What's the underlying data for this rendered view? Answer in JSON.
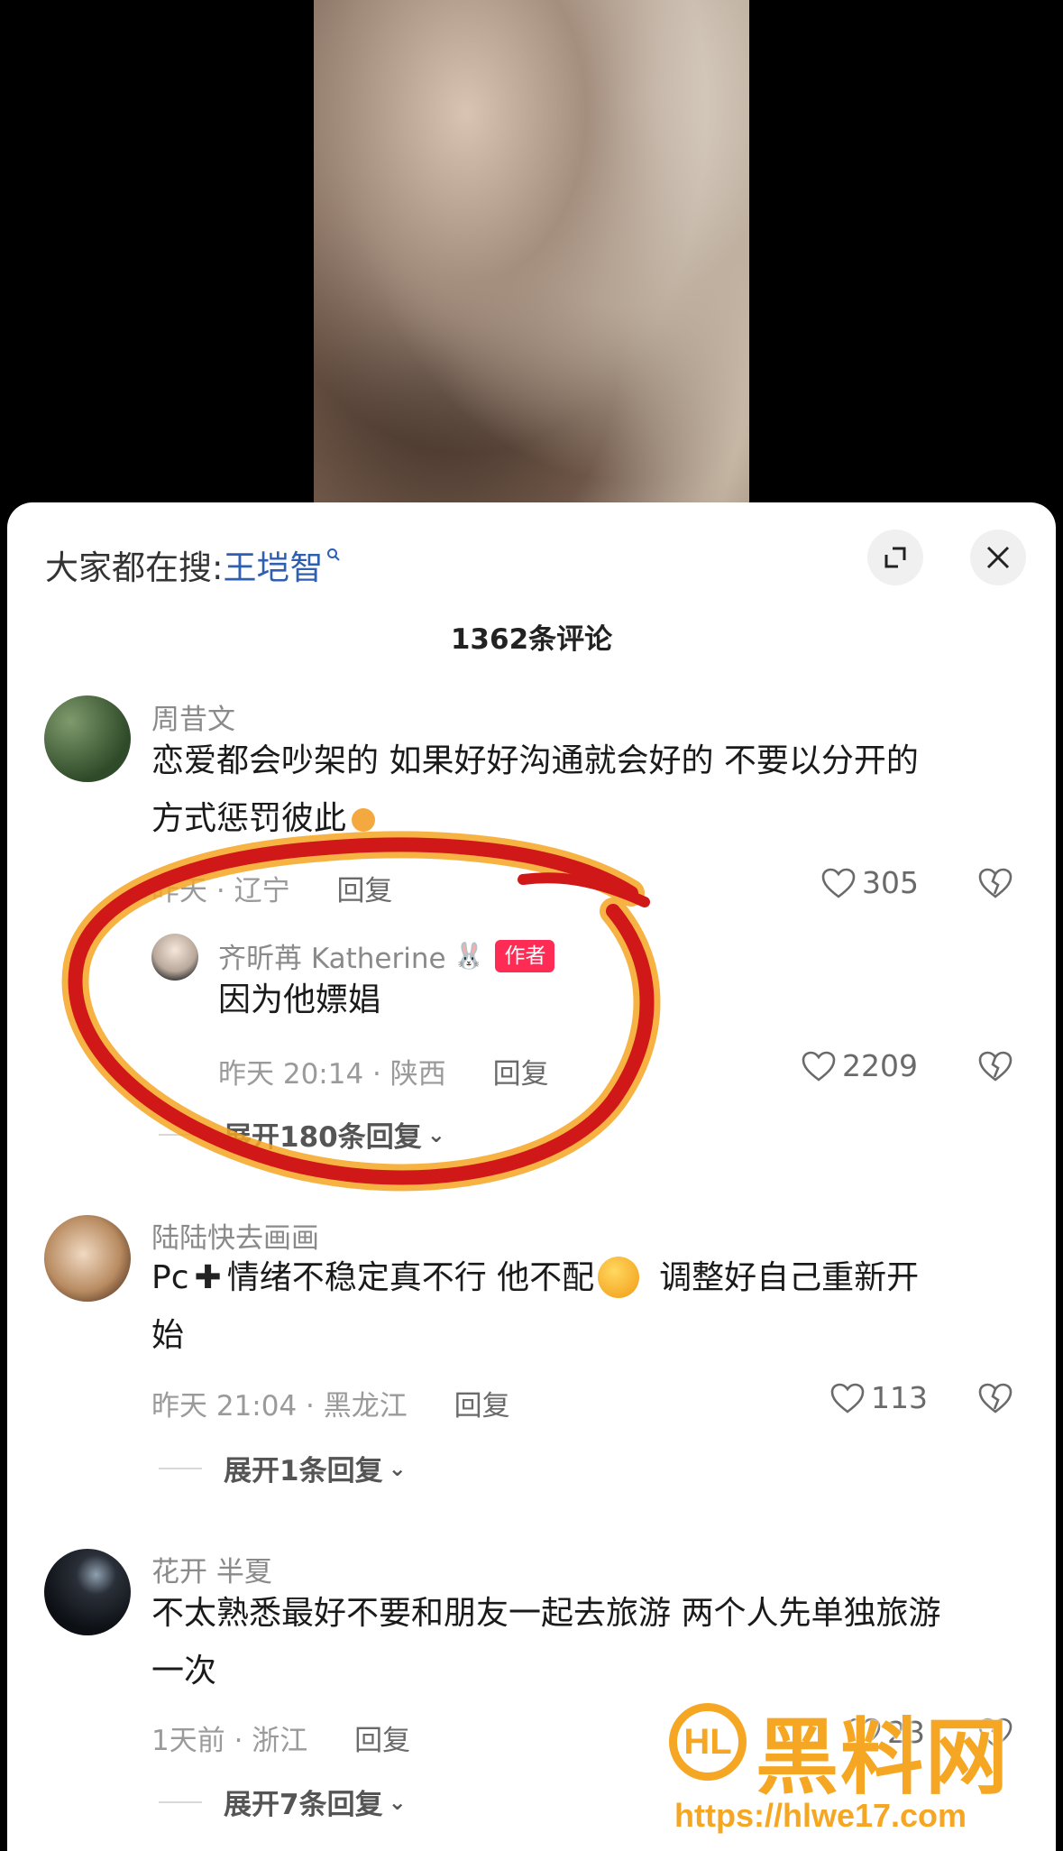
{
  "hot_search": {
    "prefix": "大家都在搜:",
    "keyword": "王垲智"
  },
  "comment_count": "1362条评论",
  "comments": [
    {
      "user": "周昔文",
      "text_line1": "恋爱都会吵架的  如果好好沟通就会好的  不要以分开的",
      "text_line2": "方式惩罚彼此",
      "time": "昨天",
      "location": "辽宁",
      "reply": "回复",
      "likes": "305",
      "replies": [
        {
          "user": "齐昕苒 Katherine",
          "author_tag": "作者",
          "text": "因为他嫖娼",
          "time_location": "昨天 20:14 · 陕西",
          "reply": "回复",
          "likes": "2209"
        }
      ],
      "expand_label": "展开180条回复"
    },
    {
      "user": "陆陆快去画画",
      "text_line1_a": "Pc",
      "text_line1_b": "情绪不稳定真不行 他不配",
      "text_line1_c": "调整好自己重新开",
      "text_line2": "始",
      "time_location": "昨天 21:04 · 黑龙江",
      "reply": "回复",
      "likes": "113",
      "expand_label": "展开1条回复"
    },
    {
      "user": "花开 半夏",
      "text_line1": "不太熟悉最好不要和朋友一起去旅游 两个人先单独旅游",
      "text_line2": "一次",
      "time_location": "1天前 · 浙江",
      "reply": "回复",
      "likes": "23",
      "expand_label": "展开7条回复"
    }
  ],
  "watermark": {
    "logo": "HL",
    "title": "黑料网",
    "url": "https://hlwe17.com"
  },
  "colors": {
    "accent_link": "#2f5fb0",
    "author_tag": "#fe2c55",
    "annotation_red": "#d01818",
    "watermark": "#f5a623"
  }
}
